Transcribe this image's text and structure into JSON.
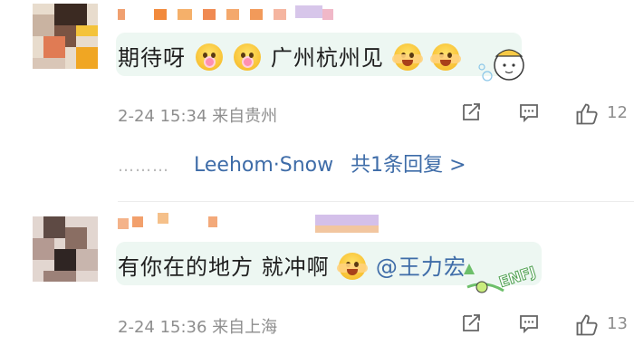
{
  "comments": [
    {
      "text_a": "期待呀",
      "text_b": "广州杭州见",
      "meta": "2-24 15:34 来自贵州",
      "like_count": "12",
      "replies": {
        "dots": "………",
        "author": "Leehom·Snow",
        "summary": "共1条回复 >"
      }
    },
    {
      "text": "有你在的地方 就冲啊",
      "mention": "@王力宏",
      "sticker_text": "ENFJ",
      "meta": "2-24 15:36 来自上海",
      "like_count": "13"
    }
  ],
  "icons": {
    "repost": "repost-icon",
    "comment": "comment-icon",
    "like": "thumbs-up-icon"
  },
  "colors": {
    "link": "#3e6ca8",
    "meta": "#8e8e8e",
    "bubble": "#edf7f2"
  }
}
